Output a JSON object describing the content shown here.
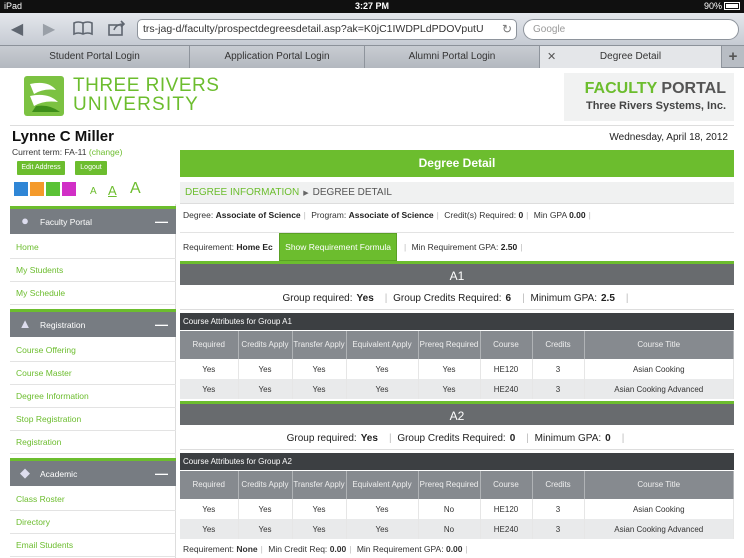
{
  "status": {
    "carrier": "iPad",
    "time": "3:27 PM",
    "battery": "90%"
  },
  "browser": {
    "url": "trs-jag-d/faculty/prospectdegreesdetail.asp?ak=K0jC1IWDPLdPDOVputU",
    "search_placeholder": "Google",
    "tabs": [
      {
        "label": "Student Portal Login"
      },
      {
        "label": "Application Portal Login"
      },
      {
        "label": "Alumni Portal Login"
      },
      {
        "label": "Degree Detail"
      }
    ]
  },
  "header": {
    "logo_line1": "THREE RIVERS",
    "logo_line2": "UNIVERSITY",
    "portal_title_1": "FACULTY",
    "portal_title_2": "PORTAL",
    "portal_sub": "Three Rivers Systems, Inc."
  },
  "user": {
    "name": "Lynne C Miller",
    "term_label": "Current term: FA-11",
    "change": "(change)",
    "edit_address": "Edit Address",
    "logout": "Logout",
    "date": "Wednesday, April 18, 2012",
    "font_a": "A",
    "swatch_colors": [
      "#2f86d6",
      "#f49a2b",
      "#5bc236",
      "#d12fc6"
    ]
  },
  "sidebar": {
    "sections": [
      {
        "title": "Faculty Portal",
        "items": [
          "Home",
          "My Students",
          "My Schedule"
        ]
      },
      {
        "title": "Registration",
        "items": [
          "Course Offering",
          "Course Master",
          "Degree Information",
          "Stop Registration",
          "Registration"
        ]
      },
      {
        "title": "Academic",
        "items": [
          "Class Roster",
          "Directory",
          "Email Students"
        ]
      }
    ]
  },
  "main": {
    "title": "Degree Detail",
    "crumb1": "DEGREE INFORMATION",
    "crumb2": "DEGREE DETAIL",
    "degree_label": "Degree:",
    "degree": "Associate of Science",
    "program_label": "Program:",
    "program": "Associate of Science",
    "credits_label": "Credit(s) Required:",
    "credits": "0",
    "mingpa_label": "Min GPA",
    "mingpa": "0.00",
    "req_label": "Requirement:",
    "req": "Home Ec",
    "formula_btn": "Show Requirement Formula",
    "min_req_gpa_label": "Min Requirement GPA:",
    "min_req_gpa": "2.50",
    "columns": [
      "Required",
      "Credits Apply",
      "Transfer Apply",
      "Equivalent Apply",
      "Prereq Required",
      "Course",
      "Credits",
      "Course Title"
    ],
    "groups": [
      {
        "name": "A1",
        "group_required_label": "Group required:",
        "group_required": "Yes",
        "group_credits_label": "Group Credits Required:",
        "group_credits": "6",
        "min_gpa_label": "Minimum GPA:",
        "min_gpa": "2.5",
        "attr_title": "Course Attributes for Group A1",
        "rows": [
          [
            "Yes",
            "Yes",
            "Yes",
            "Yes",
            "Yes",
            "HE120",
            "3",
            "Asian Cooking"
          ],
          [
            "Yes",
            "Yes",
            "Yes",
            "Yes",
            "Yes",
            "HE240",
            "3",
            "Asian Cooking Advanced"
          ]
        ]
      },
      {
        "name": "A2",
        "group_required_label": "Group required:",
        "group_required": "Yes",
        "group_credits_label": "Group Credits Required:",
        "group_credits": "0",
        "min_gpa_label": "Minimum GPA:",
        "min_gpa": "0",
        "attr_title": "Course Attributes for Group A2",
        "rows": [
          [
            "Yes",
            "Yes",
            "Yes",
            "Yes",
            "No",
            "HE120",
            "3",
            "Asian Cooking"
          ],
          [
            "Yes",
            "Yes",
            "Yes",
            "Yes",
            "No",
            "HE240",
            "3",
            "Asian Cooking Advanced"
          ]
        ]
      }
    ],
    "footer": {
      "req_label": "Requirement:",
      "req": "None",
      "min_credit_label": "Min Credit Req:",
      "min_credit": "0.00",
      "min_gpa_label": "Min Requirement GPA:",
      "min_gpa": "0.00"
    }
  }
}
